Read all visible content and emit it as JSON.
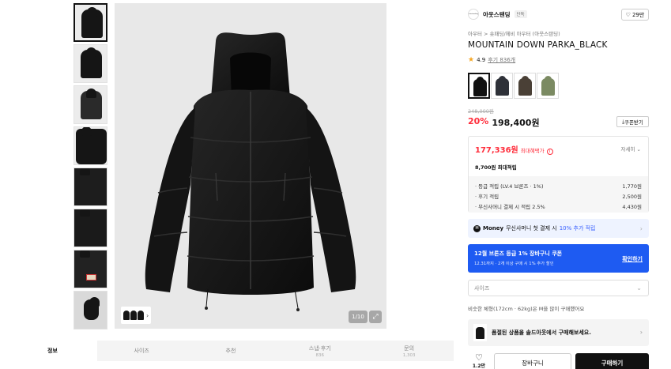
{
  "gallery": {
    "counter": "1/10"
  },
  "tabs": [
    {
      "label": "정보",
      "sub": ""
    },
    {
      "label": "사이즈",
      "sub": ""
    },
    {
      "label": "추천",
      "sub": ""
    },
    {
      "label": "스냅·후기",
      "sub": "836"
    },
    {
      "label": "문의",
      "sub": "1,303"
    }
  ],
  "brand": {
    "logo_text": "outstanding",
    "name": "아웃스탠딩",
    "tag": "단독",
    "likes": "29만"
  },
  "product": {
    "breadcrumb": "아우터 > 숏패딩/헤비 아우터 (아웃스탠딩)",
    "title": "MOUNTAIN DOWN PARKA_BLACK",
    "rating": "4.9",
    "review_link": "후기 836개",
    "color_options": [
      "#111111",
      "#2e3138",
      "#4a4036",
      "#7b8a62"
    ],
    "original_price": "248,000원",
    "discount": "20%",
    "price": "198,400원",
    "coupon_button": "쿠폰받기"
  },
  "benefit": {
    "max_price": "177,336원",
    "max_label": "최대혜택가",
    "detail_link": "자세히",
    "points_max": "8,700원 최대적립",
    "rows": [
      {
        "label": "· 등급 적립 (LV.4 브론즈 · 1%)",
        "value": "1,770원"
      },
      {
        "label": "· 후기 적립",
        "value": "2,500원"
      },
      {
        "label": "· 무신사머니 결제 시 적립 2.5%",
        "value": "4,430원"
      }
    ]
  },
  "money": {
    "logo": "M",
    "name": "Money",
    "text": "무신사머니 첫 결제 시",
    "highlight": "10% 추가 적립"
  },
  "coupon_banner": {
    "title": "12월 브론즈 등급 1% 장바구니 쿠폰",
    "sub": "12.31까지 · 2개 이상 구매 시 1% 추가 할인",
    "link": "확인하기"
  },
  "size_select": {
    "placeholder": "사이즈"
  },
  "fit_note": "비슷한 체형(172cm · 62kg)은 M을 많이 구매했어요",
  "soldout": {
    "text": "품절된 상품을 솔드아웃에서 구매해보세요."
  },
  "actions": {
    "wish_count": "1.2만",
    "cart": "장바구니",
    "buy": "구매하기"
  }
}
